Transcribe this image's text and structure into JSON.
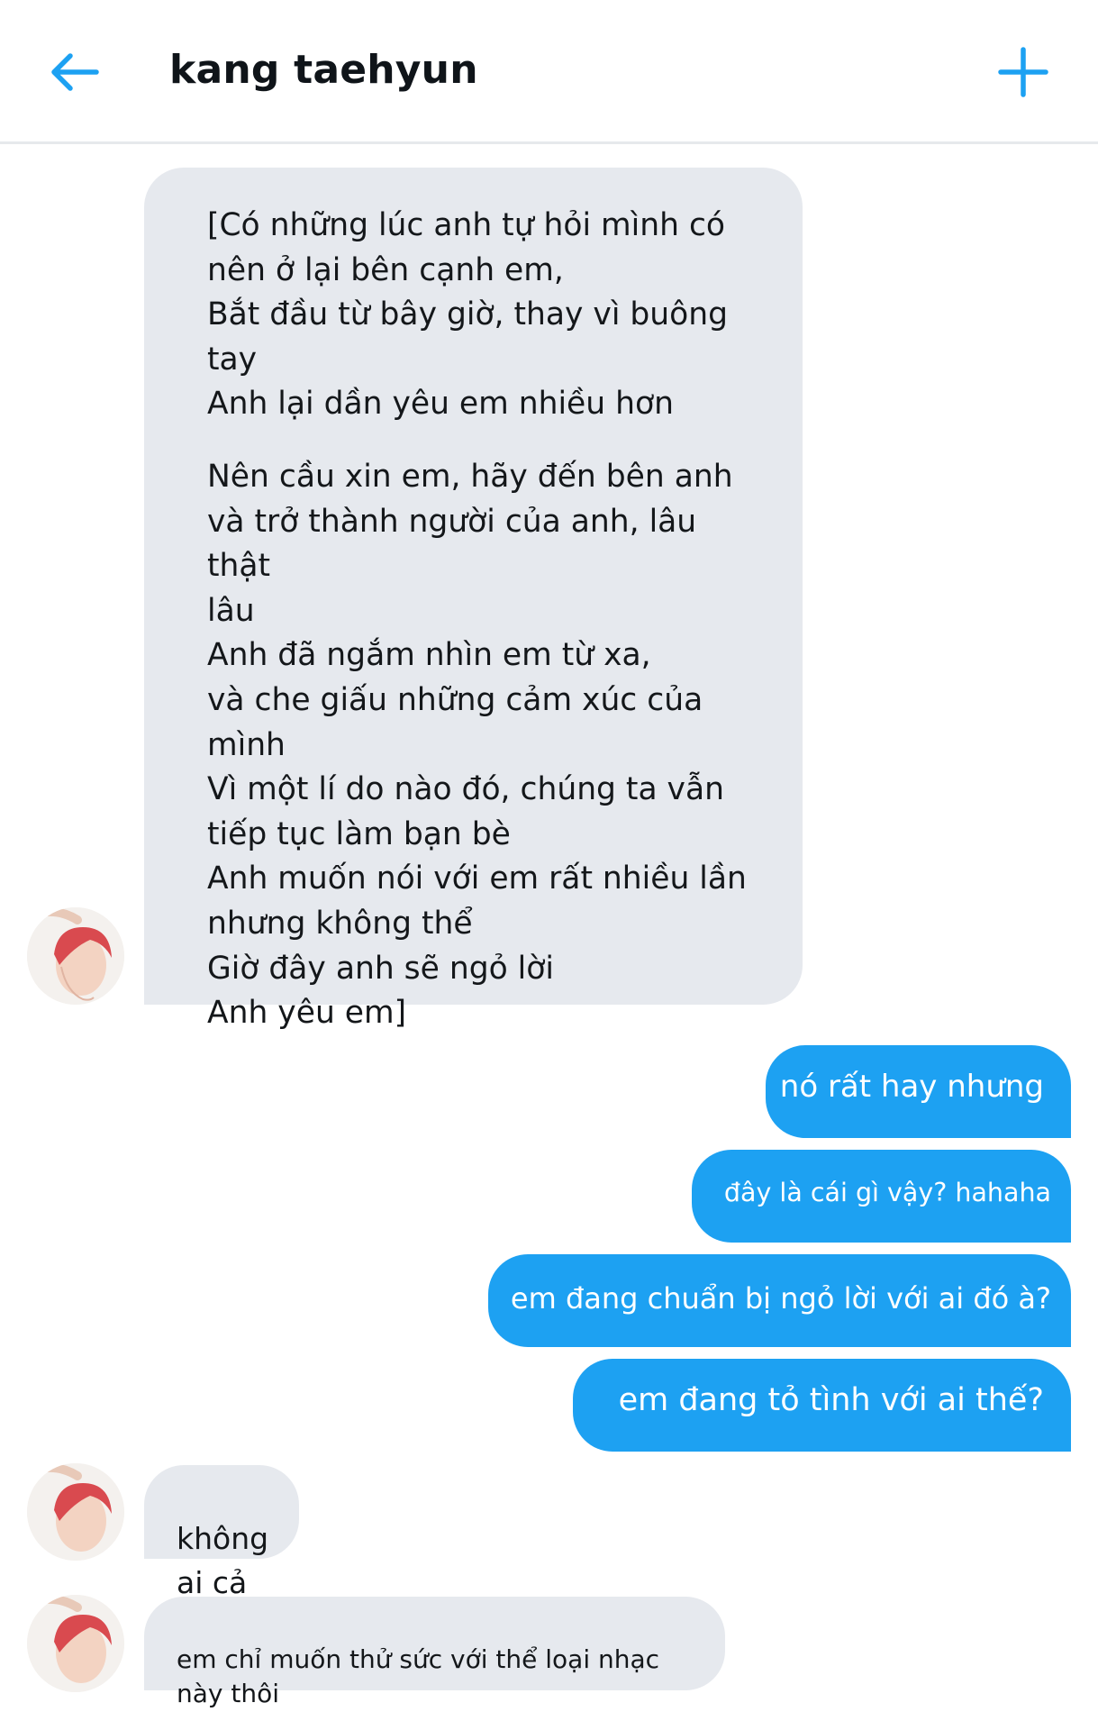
{
  "header": {
    "title": "kang taehyun",
    "back_icon": "arrow-left-icon",
    "add_icon": "plus-icon",
    "accent": "#1da1f2"
  },
  "messages": {
    "poem": {
      "stanza1": "[Có những lúc anh tự hỏi mình có\nnên ở lại bên cạnh em,\nBắt đầu từ bây giờ, thay vì buông tay\nAnh lại dần yêu em nhiều hơn",
      "stanza2": "Nên cầu xin em, hãy đến bên anh\nvà trở thành người của anh, lâu thật\nlâu\nAnh đã ngắm nhìn em từ xa,\nvà che giấu những cảm xúc của\nmình\nVì một lí do nào đó, chúng ta vẫn\ntiếp tục làm bạn bè\nAnh muốn nói với em rất nhiều lần\nnhưng không thể\nGiờ đây anh sẽ ngỏ lời\nAnh yêu em]"
    },
    "out1": "nó rất hay nhưng",
    "out2": "đây là cái gì vậy? hahaha",
    "out3": "em đang chuẩn bị ngỏ lời với ai đó à?",
    "out4": "em đang tỏ tình với ai thế?",
    "in1": "không\nai cả",
    "in2": "em chỉ muốn thử sức với thể loại nhạc\nnày thôi"
  }
}
